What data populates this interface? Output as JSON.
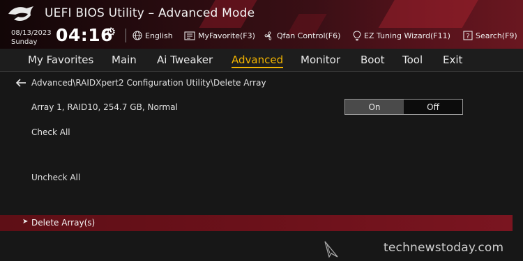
{
  "header": {
    "title": "UEFI BIOS Utility – Advanced Mode",
    "date": "08/13/2023",
    "day": "Sunday",
    "time": "04:16",
    "buttons": [
      {
        "label": "English",
        "icon": "globe-icon"
      },
      {
        "label": "MyFavorite(F3)",
        "icon": "favorite-icon"
      },
      {
        "label": "Qfan Control(F6)",
        "icon": "fan-icon"
      },
      {
        "label": "EZ Tuning Wizard(F11)",
        "icon": "lightbulb-icon"
      },
      {
        "label": "Search(F9)",
        "icon": "help-icon"
      }
    ]
  },
  "menu": {
    "items": [
      "My Favorites",
      "Main",
      "Ai Tweaker",
      "Advanced",
      "Monitor",
      "Boot",
      "Tool",
      "Exit"
    ],
    "active": "Advanced"
  },
  "breadcrumb": "Advanced\\RAIDXpert2 Configuration Utility\\Delete Array",
  "rows": {
    "array": "Array 1, RAID10, 254.7 GB, Normal",
    "check_all": "Check All",
    "uncheck_all": "Uncheck All",
    "delete_arrays": "Delete Array(s)"
  },
  "toggle": {
    "on_label": "On",
    "off_label": "Off",
    "selected": "On"
  },
  "watermark": "technewstoday.com",
  "colors": {
    "accent": "#f2b400",
    "highlight_row": "#6b111a",
    "background": "#171717"
  }
}
